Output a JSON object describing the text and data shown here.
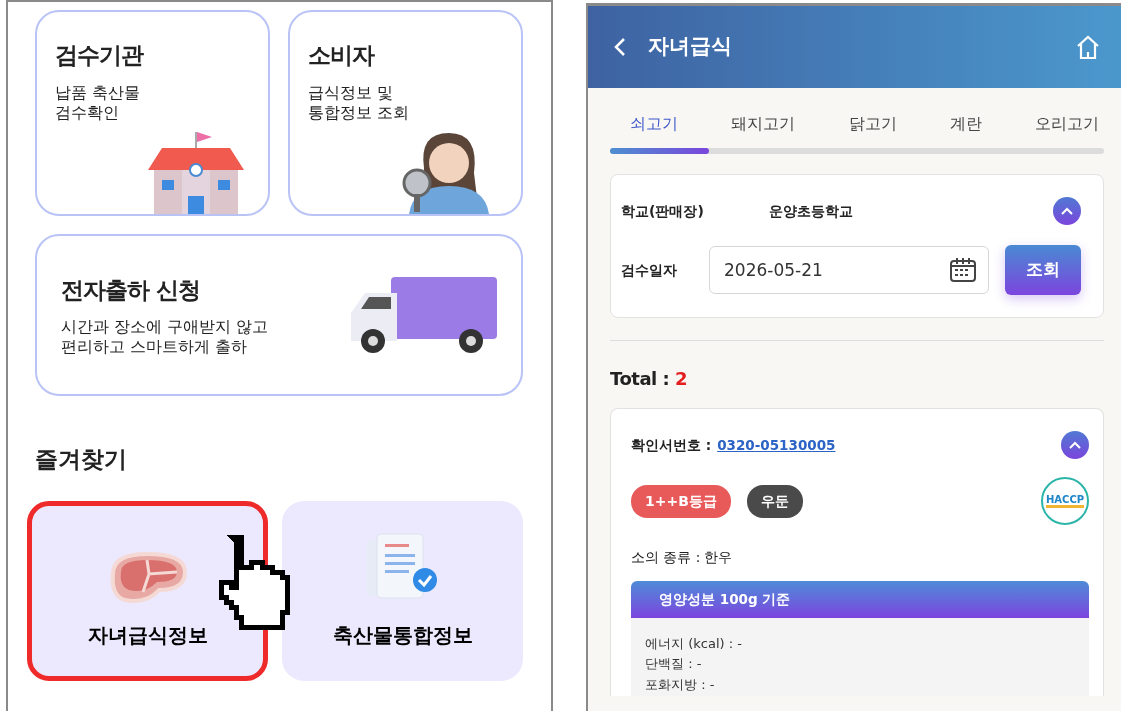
{
  "left_screen": {
    "service_cards": [
      {
        "title": "검수기관",
        "lines": [
          "납품 축산물",
          "검수확인"
        ],
        "kind": "school"
      },
      {
        "title": "소비자",
        "lines": [
          "급식정보 및",
          "통합정보 조회"
        ],
        "kind": "person"
      }
    ],
    "shipping_card": {
      "title": "전자출하 신청",
      "lines": [
        "시간과 장소에 구애받지 않고",
        "편리하고 스마트하게 출하"
      ]
    },
    "favorites": {
      "heading": "즐겨찾기",
      "items": [
        {
          "label": "자녀급식정보",
          "kind": "meat",
          "selected": true
        },
        {
          "label": "축산물통합정보",
          "kind": "documents",
          "selected": false
        }
      ]
    }
  },
  "right_screen": {
    "header": {
      "title": "자녀급식"
    },
    "tabs": [
      {
        "label": "쇠고기",
        "selected": true
      },
      {
        "label": "돼지고기",
        "selected": false
      },
      {
        "label": "닭고기",
        "selected": false
      },
      {
        "label": "계란",
        "selected": false
      },
      {
        "label": "오리고기",
        "selected": false
      }
    ],
    "search": {
      "school_label": "학교(판매장)",
      "school_value": "운양초등학교",
      "expanded": true,
      "date_label": "검수일자",
      "date_value": "2026-05-21",
      "button": "조회"
    },
    "total_label": "Total :",
    "total_value": "2",
    "result": {
      "cert_label": "확인서번호 :",
      "cert_number": "0320-05130005",
      "expanded": true,
      "tags": [
        {
          "text": "1++B등급",
          "color": "#e85a5a"
        },
        {
          "text": "우둔",
          "color": "#4a4a4a"
        }
      ],
      "haccp": "HACCP",
      "breed": "소의 종류 : 한우",
      "nutrition": {
        "title": "영양성분 100g 기준",
        "rows": [
          "에너지 (kcal) : -",
          "단백질 : -",
          "포화지방 : -"
        ]
      }
    }
  }
}
